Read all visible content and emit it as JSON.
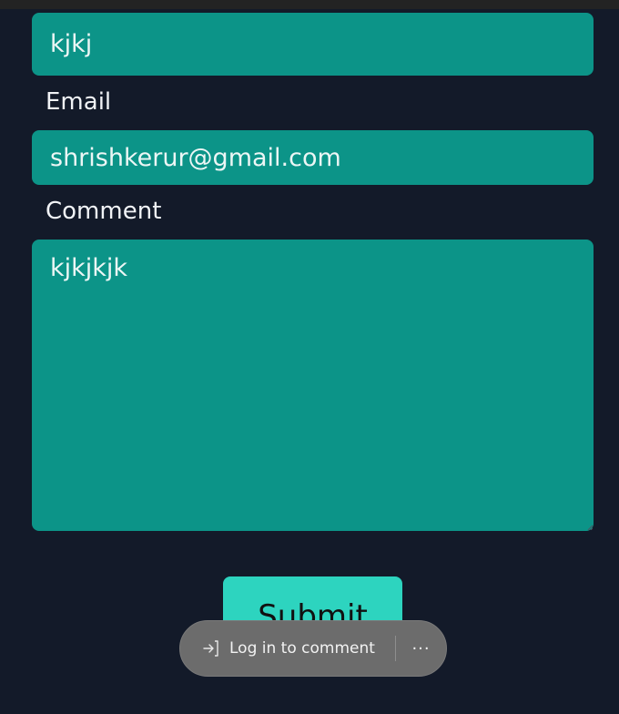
{
  "form": {
    "name_value": "kjkj",
    "email_label": "Email",
    "email_value": "shrishkerur@gmail.com",
    "comment_label": "Comment",
    "comment_value": "kjkjkjk",
    "submit_label": "Submit"
  },
  "toast": {
    "login_label": "Log in to comment",
    "more_label": "···",
    "login_icon": "sign-in-icon",
    "more_icon": "more-icon"
  },
  "colors": {
    "background": "#131a29",
    "field": "#0c9488",
    "submit": "#2dd4bf",
    "toast": "#6c6c6c"
  }
}
